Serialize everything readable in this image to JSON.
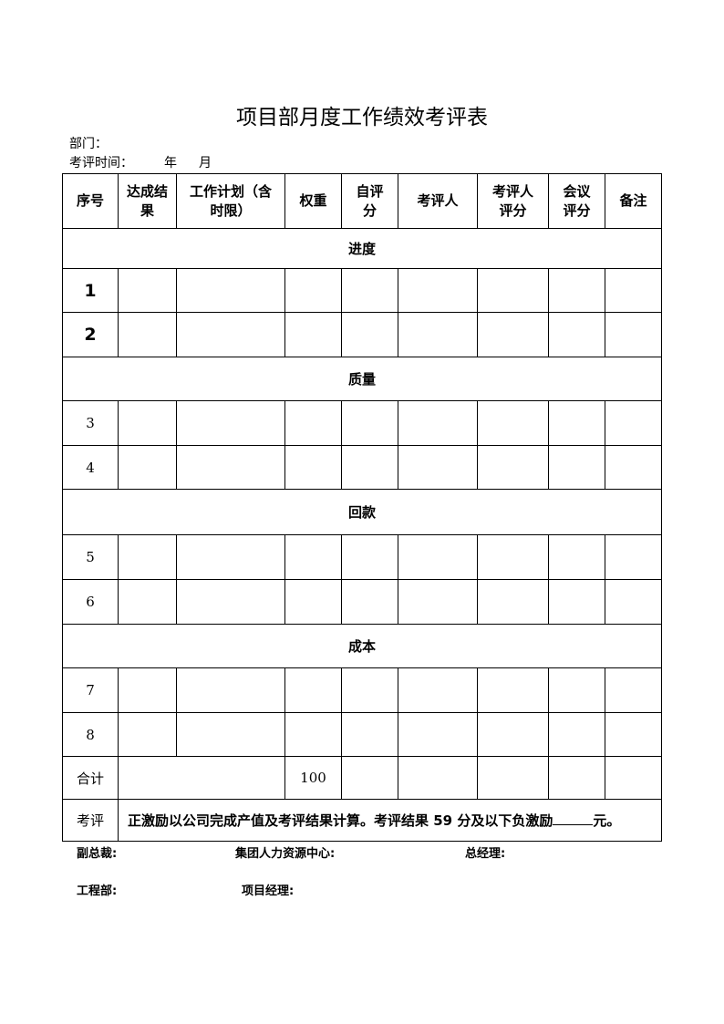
{
  "title": "项目部月度工作绩效考评表",
  "meta": {
    "department_label": "部门：",
    "period_label": "考评时间：",
    "year_label": "年",
    "month_label": "月"
  },
  "table": {
    "headers": [
      {
        "line1": "序号",
        "line2": ""
      },
      {
        "line1": "达成结",
        "line2": "果"
      },
      {
        "line1": "工作计划（含",
        "line2": "时限）"
      },
      {
        "line1": "权重",
        "line2": ""
      },
      {
        "line1": "自评",
        "line2": "分"
      },
      {
        "line1": "考评人",
        "line2": ""
      },
      {
        "line1": "考评人",
        "line2": "评分"
      },
      {
        "line1": "会议",
        "line2": "评分"
      },
      {
        "line1": "备注",
        "line2": ""
      }
    ],
    "sections": [
      {
        "name": "进度",
        "rows": [
          "1",
          "2"
        ]
      },
      {
        "name": "质量",
        "rows": [
          "3",
          "4"
        ]
      },
      {
        "name": "回款",
        "rows": [
          "5",
          "6"
        ]
      },
      {
        "name": "成本",
        "rows": [
          "7",
          "8"
        ]
      }
    ],
    "total": {
      "label": "合计",
      "weight": "100"
    },
    "evaluation": {
      "label": "考评",
      "text_before": "正激励以公司完成产值及考评结果计算。考评结果 59 分及以下负激励",
      "text_after": "元。"
    }
  },
  "signatures": {
    "vice_president": "副总裁:",
    "hr_center": "集团人力资源中心:",
    "general_manager": "总经理:",
    "engineering_dept": "工程部:",
    "project_manager": "项目经理:"
  }
}
